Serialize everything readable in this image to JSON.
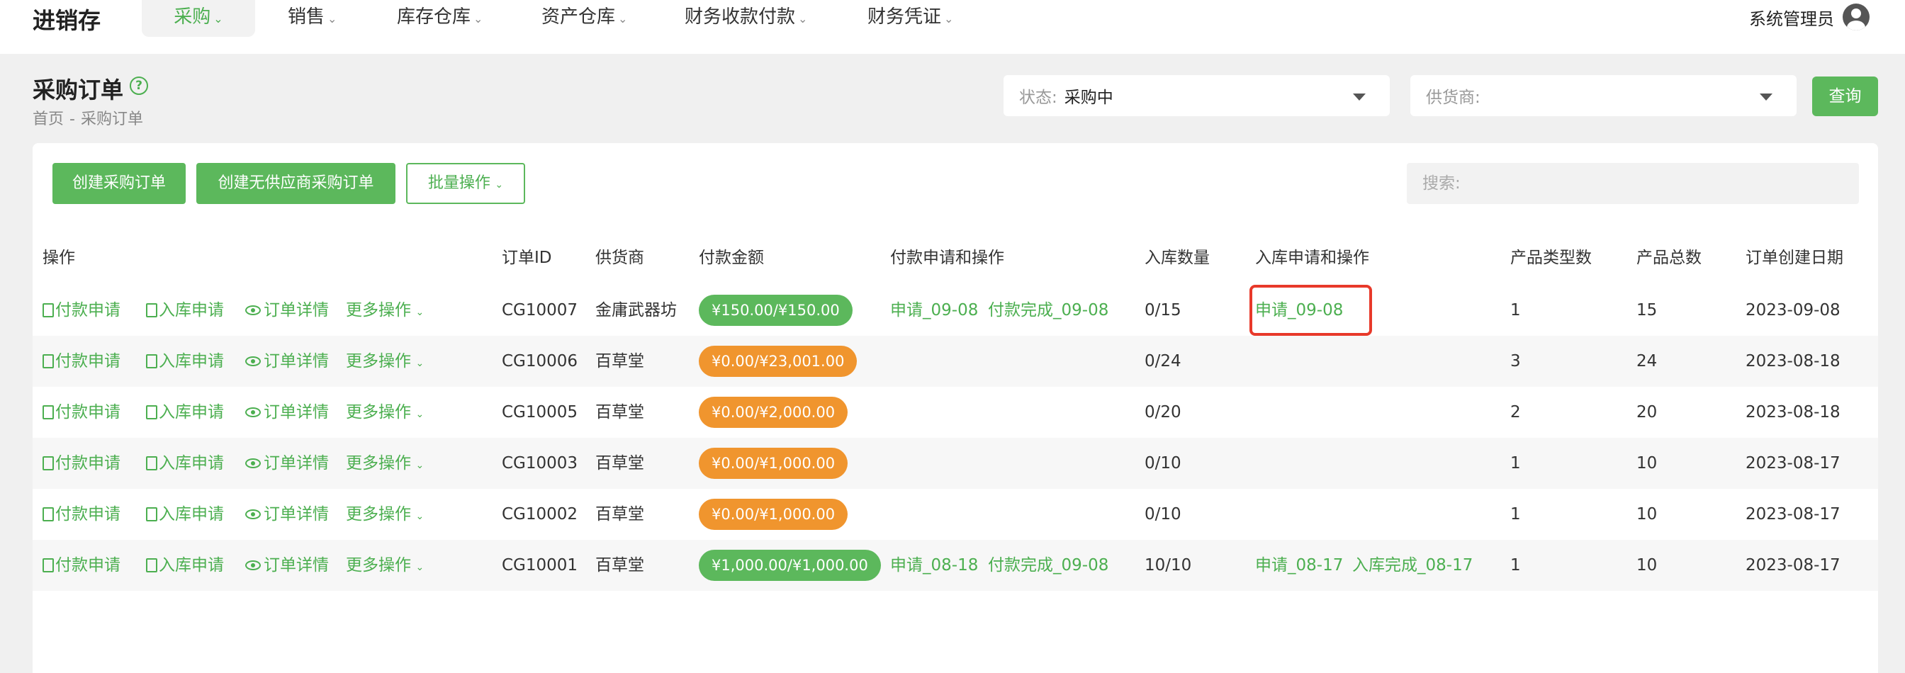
{
  "app": {
    "logo": "进销存"
  },
  "nav": {
    "items": [
      {
        "label": "采购",
        "active": true
      },
      {
        "label": "销售"
      },
      {
        "label": "库存仓库"
      },
      {
        "label": "资产仓库"
      },
      {
        "label": "财务收款付款"
      },
      {
        "label": "财务凭证"
      }
    ],
    "user": "系统管理员"
  },
  "page": {
    "title": "采购订单",
    "breadcrumb": [
      "首页",
      "-",
      "采购订单"
    ]
  },
  "filters": {
    "status_label": "状态:",
    "status_value": "采购中",
    "supplier_label": "供货商:",
    "supplier_value": "",
    "query_button": "查询"
  },
  "toolbar": {
    "create_order": "创建采购订单",
    "create_no_supplier": "创建无供应商采购订单",
    "batch": "批量操作",
    "search_placeholder": "搜索:"
  },
  "table": {
    "headers": [
      "操作",
      "订单ID",
      "供货商",
      "付款金额",
      "付款申请和操作",
      "入库数量",
      "入库申请和操作",
      "产品类型数",
      "产品总数",
      "订单创建日期"
    ],
    "actions": [
      "付款申请",
      "入库申请",
      "订单详情",
      "更多操作"
    ],
    "rows": [
      {
        "id": "CG10007",
        "supplier": "金庸武器坊",
        "amount": "¥150.00/¥150.00",
        "amount_status": "paid",
        "pay_apply": "申请_09-08",
        "pay_done": "付款完成_09-08",
        "stock_qty": "0/15",
        "stock_apply": "申请_09-08",
        "stock_done": "",
        "types": "1",
        "total": "15",
        "date": "2023-09-08"
      },
      {
        "id": "CG10006",
        "supplier": "百草堂",
        "amount": "¥0.00/¥23,001.00",
        "amount_status": "unpaid",
        "pay_apply": "",
        "pay_done": "",
        "stock_qty": "0/24",
        "stock_apply": "",
        "stock_done": "",
        "types": "3",
        "total": "24",
        "date": "2023-08-18"
      },
      {
        "id": "CG10005",
        "supplier": "百草堂",
        "amount": "¥0.00/¥2,000.00",
        "amount_status": "unpaid",
        "pay_apply": "",
        "pay_done": "",
        "stock_qty": "0/20",
        "stock_apply": "",
        "stock_done": "",
        "types": "2",
        "total": "20",
        "date": "2023-08-18"
      },
      {
        "id": "CG10003",
        "supplier": "百草堂",
        "amount": "¥0.00/¥1,000.00",
        "amount_status": "unpaid",
        "pay_apply": "",
        "pay_done": "",
        "stock_qty": "0/10",
        "stock_apply": "",
        "stock_done": "",
        "types": "1",
        "total": "10",
        "date": "2023-08-17"
      },
      {
        "id": "CG10002",
        "supplier": "百草堂",
        "amount": "¥0.00/¥1,000.00",
        "amount_status": "unpaid",
        "pay_apply": "",
        "pay_done": "",
        "stock_qty": "0/10",
        "stock_apply": "",
        "stock_done": "",
        "types": "1",
        "total": "10",
        "date": "2023-08-17"
      },
      {
        "id": "CG10001",
        "supplier": "百草堂",
        "amount": "¥1,000.00/¥1,000.00",
        "amount_status": "paid",
        "pay_apply": "申请_08-18",
        "pay_done": "付款完成_09-08",
        "stock_qty": "10/10",
        "stock_apply": "申请_08-17",
        "stock_done": "入库完成_08-17",
        "types": "1",
        "total": "10",
        "date": "2023-08-17"
      }
    ]
  },
  "colors": {
    "accent": "#5cb85c",
    "unpaid": "#f0952e",
    "highlight": "#e8392a"
  }
}
